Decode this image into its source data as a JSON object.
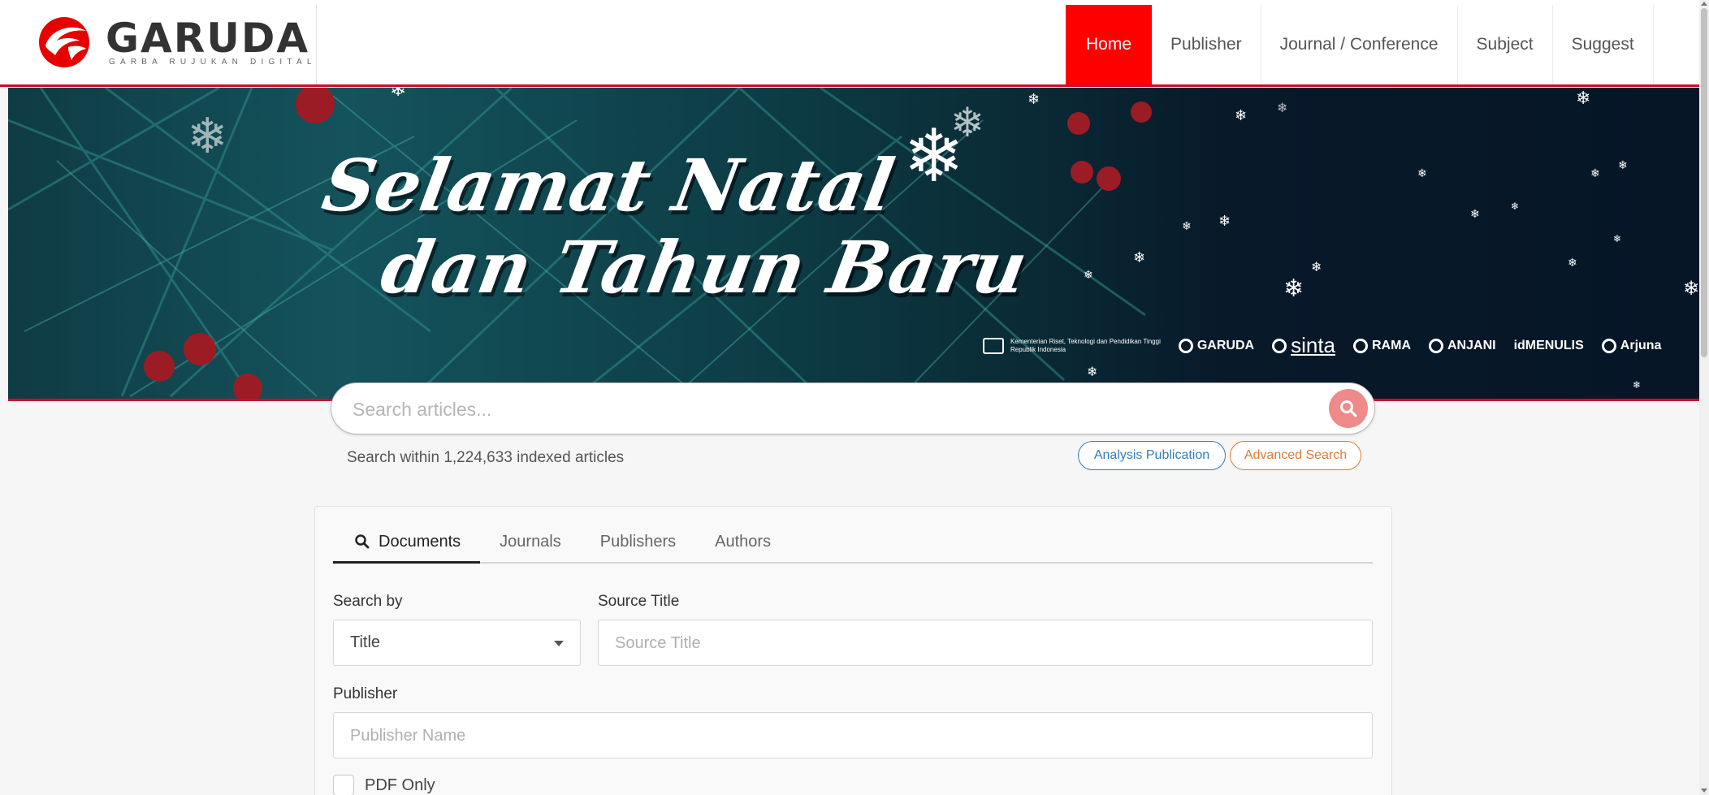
{
  "logo": {
    "word": "GARUDA",
    "tagline": "GARBA RUJUKAN DIGITAL",
    "brand_color": "#e60000"
  },
  "nav": {
    "items": [
      {
        "label": "Home",
        "active": true
      },
      {
        "label": "Publisher",
        "active": false
      },
      {
        "label": "Journal / Conference",
        "active": false
      },
      {
        "label": "Subject",
        "active": false
      },
      {
        "label": "Suggest",
        "active": false
      }
    ],
    "active_color": "#ff0000"
  },
  "banner": {
    "greeting_line1": "Selamat Natal",
    "greeting_line2": "dan Tahun Baru",
    "ministry": "Kementerian Riset, Teknologi dan Pendidikan Tinggi",
    "ministry_sub": "Republik Indonesia",
    "partners": [
      "GARUDA",
      "sinta",
      "RAMA",
      "ANJANI",
      "idMENULIS",
      "Arjuna"
    ]
  },
  "search": {
    "placeholder": "Search articles...",
    "hint": "Search within 1,224,633 indexed articles",
    "analysis_label": "Analysis Publication",
    "advanced_label": "Advanced Search",
    "button_icon": "search-icon"
  },
  "form": {
    "tabs": [
      {
        "label": "Documents",
        "active": true
      },
      {
        "label": "Journals",
        "active": false
      },
      {
        "label": "Publishers",
        "active": false
      },
      {
        "label": "Authors",
        "active": false
      }
    ],
    "search_by_label": "Search by",
    "search_by_value": "Title",
    "source_title_label": "Source Title",
    "source_title_placeholder": "Source Title",
    "publisher_label": "Publisher",
    "publisher_placeholder": "Publisher Name",
    "pdf_only_label": "PDF Only"
  }
}
